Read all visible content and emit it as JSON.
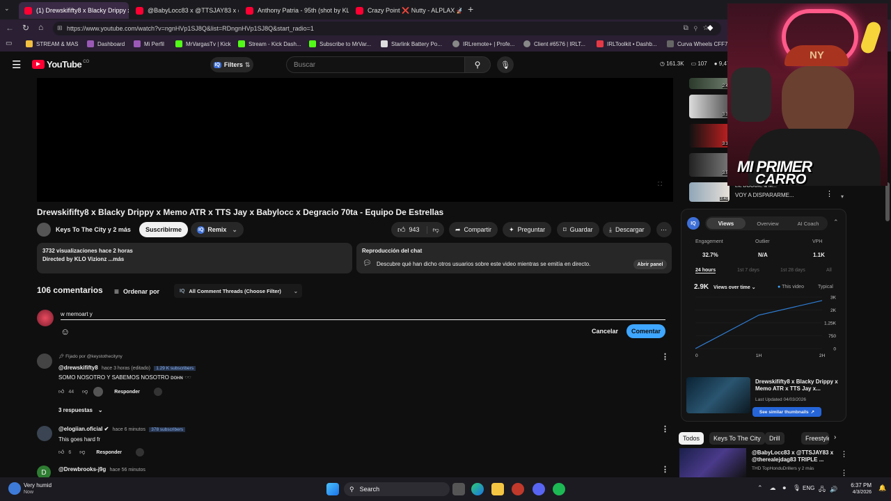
{
  "browser": {
    "tabs": [
      {
        "title": "(1) Drewskififty8 x Blacky Drippy x",
        "active": true
      },
      {
        "title": "@BabyLocc83 x @TTSJAY83 x @th"
      },
      {
        "title": "Anthony Patria - 95th (shot by KLO"
      },
      {
        "title": "Crazy Point ❌ Nutty - ALPLAX 🚀"
      }
    ],
    "url": "https://www.youtube.com/watch?v=ngnHVp1SJ8Q&list=RDngnHVp1SJ8Q&start_radio=1",
    "bookmarks": [
      "STREAM & MAS",
      "Dashboard",
      "Mi Perfil",
      "MrVargasTv | Kick",
      "Stream - Kick Dash...",
      "Subscribe to MrVar...",
      "Starlink Battery Po...",
      "IRLremote+ | Profe...",
      "Client #6576 | IRLT...",
      "IRLToolkit • Dashb...",
      "Curva Wheels CFF76"
    ]
  },
  "youtube": {
    "logo": "YouTube",
    "logo_sup": "CO",
    "filters": "Filters",
    "search_placeholder": "Buscar",
    "stats": [
      "161.3K",
      "107",
      "9,477"
    ]
  },
  "video": {
    "title": "Drewskififty8 x Blacky Drippy x Memo ATR x TTS Jay x Babylocc x Degracio 70ta - Equipo De Estrellas",
    "channel": "Keys To The City y 2 más",
    "subscribe": "Suscribirme",
    "remix": "Remix",
    "likes": "943",
    "share": "Compartir",
    "ask": "Preguntar",
    "save": "Guardar",
    "download": "Descargar",
    "views_line": "3732 visualizaciones  hace 2 horas",
    "desc_line": "Directed by KLO Vizionz ...más",
    "chat_title": "Reproducción del chat",
    "chat_text": "Descubre qué han dicho otros usuarios sobre este video mientras se emitía en directo.",
    "chat_button": "Abrir panel"
  },
  "comments": {
    "count": "106 comentarios",
    "sort": "Ordenar por",
    "filter": "All Comment Threads (Choose Filter)",
    "draft": "w memoart y",
    "cancel": "Cancelar",
    "submit": "Comentar",
    "items": [
      {
        "pinned": "Fijado por @keystothecityny",
        "author": "@drewskififty8",
        "time": "hace 3 horas (editado)",
        "subs": "1.29 K subscribers",
        "text": "SOMO NOSOTRO Y SABEMOS NOSOTRO ᴅᴏʜɴ 🕶️",
        "likes": "44",
        "reply": "Responder",
        "replies": "3 respuestas"
      },
      {
        "author": "@elogiian.oficial ✔",
        "time": "hace 6 minutos",
        "subs": "378 subscribers",
        "text": "This goes hard fr",
        "likes": "6",
        "reply": "Responder"
      },
      {
        "author": "@Drewbrooks-j9g",
        "time": "hace 56 minutos"
      }
    ]
  },
  "sidebar": {
    "thumb_times": [
      "2:4",
      "3:3",
      "3:1",
      "3:5",
      "3:40"
    ],
    "row_text": "VOY A DISPARARME...",
    "row_text2": "LIL DOOGIE & M...",
    "iq_tabs": [
      "Views",
      "Overview",
      "AI Coach"
    ],
    "metrics": [
      {
        "label": "Engagement",
        "value": "32.7%"
      },
      {
        "label": "Outlier",
        "value": "N/A"
      },
      {
        "label": "VPH",
        "value": "1.1K"
      }
    ],
    "ranges": [
      "24 hours",
      "1st 7 days",
      "1st 28 days",
      "All"
    ],
    "views_total": "2.9K",
    "views_select": "Views over time",
    "legend": [
      "This video",
      "Typical"
    ],
    "chart_data": {
      "type": "line",
      "x": [
        "0",
        "1H",
        "2H"
      ],
      "series": [
        {
          "name": "This video",
          "values": [
            0,
            1950,
            2800
          ]
        }
      ],
      "yticks": [
        "3K",
        "2K",
        "1.25K",
        "750",
        "0"
      ],
      "ylim": [
        0,
        3000
      ]
    },
    "card_title": "Drewskififty8 x Blacky Drippy x Memo ATR x TTS Jay x...",
    "card_meta": "Last Updated 04/03/2026",
    "card_button": "See similar thumbnails",
    "chips": [
      "Todos",
      "Keys To The City",
      "Drill",
      "Freestyle ra"
    ],
    "next_title": "@BabyLocc83 x @TTSJAY83 x @therealejdag83 TRIPLE ...",
    "next_channel": "THD TopHonduDrillers y 2 más"
  },
  "webcam": {
    "caption1": "MI PRIMER",
    "caption2": "CARRO"
  },
  "taskbar": {
    "weather_title": "Very humid",
    "weather_sub": "Now",
    "search": "Search",
    "lang": "ENG",
    "time": "6:37 PM",
    "date": "4/3/2026"
  }
}
